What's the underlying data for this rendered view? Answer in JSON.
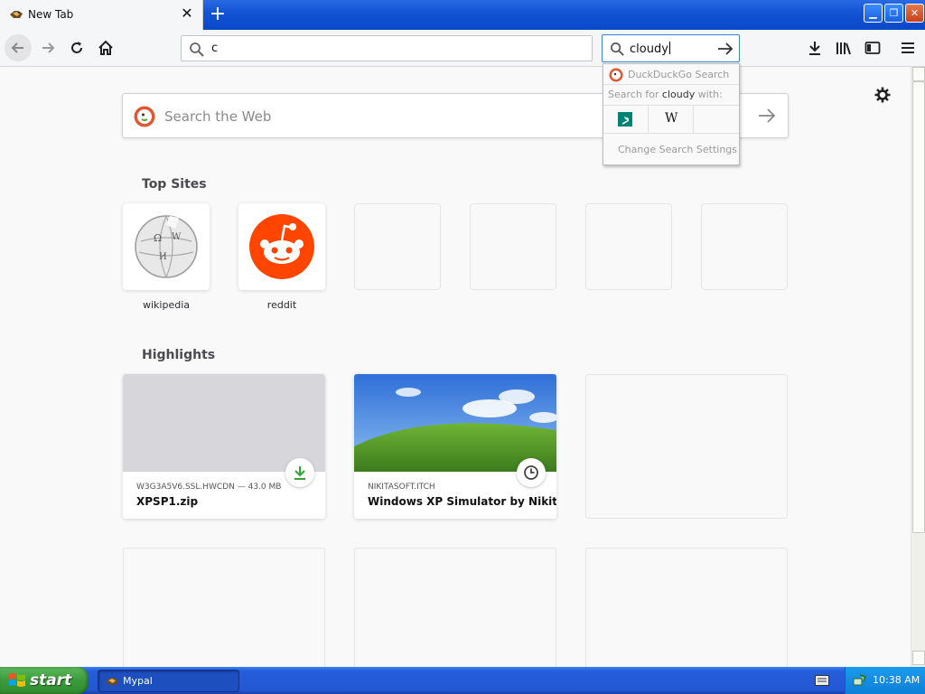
{
  "browser": {
    "tab_title": "New Tab",
    "url_value": "c",
    "search_value": "cloudy"
  },
  "search_popup": {
    "engine_name": "DuckDuckGo Search",
    "search_for_prefix": "Search for ",
    "search_for_term": "cloudy",
    "search_for_suffix": " with:",
    "wikipedia_glyph": "W",
    "change_settings": "Change Search Settings"
  },
  "newtab": {
    "search_placeholder": "Search the Web",
    "top_sites_title": "Top Sites",
    "top_sites": [
      {
        "label": "wikipedia",
        "icon": "wikipedia-globe-icon"
      },
      {
        "label": "reddit",
        "icon": "reddit-alien-icon"
      },
      {
        "label": "",
        "icon": ""
      },
      {
        "label": "",
        "icon": ""
      },
      {
        "label": "",
        "icon": ""
      },
      {
        "label": "",
        "icon": ""
      }
    ],
    "highlights_title": "Highlights",
    "highlights": [
      {
        "source": "W3G3A5V6.SSL.HWCDN — 43.0 MB",
        "title": "XPSP1.zip",
        "badge": "download-icon"
      },
      {
        "source": "NIKITASOFT.ITCH",
        "title": "Windows XP Simulator by Nikita...",
        "badge": "history-clock-icon"
      }
    ]
  },
  "taskbar": {
    "start_label": "start",
    "task_label": "Mypal",
    "clock": "10:38 AM"
  },
  "colors": {
    "accent": "#3b7ddd",
    "reddit": "#ff4500",
    "download_green": "#2ea52e",
    "xp_blue": "#245edb"
  }
}
